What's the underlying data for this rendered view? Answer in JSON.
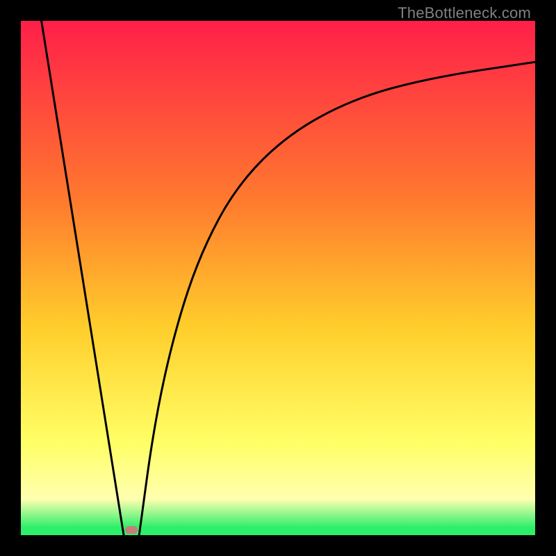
{
  "watermark": "TheBottleneck.com",
  "colors": {
    "top": "#ff1f49",
    "mid_upper": "#ff7a2e",
    "mid": "#ffcf2c",
    "mid_lower": "#ffff66",
    "pale_yellow": "#ffffb0",
    "green": "#2eef6a",
    "black": "#000000",
    "marker": "#c97d7b"
  },
  "chart_data": {
    "type": "line",
    "title": "",
    "xlabel": "",
    "ylabel": "",
    "xlim": [
      0,
      100
    ],
    "ylim": [
      0,
      100
    ],
    "min_point": {
      "x": 21,
      "y": 0
    },
    "left_segment": {
      "start": {
        "x": 4,
        "y": 100
      },
      "end": {
        "x": 20,
        "y": 0
      }
    },
    "right_curve": [
      {
        "x": 23,
        "y": 0
      },
      {
        "x": 26,
        "y": 22
      },
      {
        "x": 30,
        "y": 40
      },
      {
        "x": 35,
        "y": 55
      },
      {
        "x": 42,
        "y": 68
      },
      {
        "x": 52,
        "y": 78
      },
      {
        "x": 65,
        "y": 85
      },
      {
        "x": 80,
        "y": 89
      },
      {
        "x": 100,
        "y": 92
      }
    ],
    "marker": {
      "x": 21.5,
      "y": 0.6
    }
  }
}
